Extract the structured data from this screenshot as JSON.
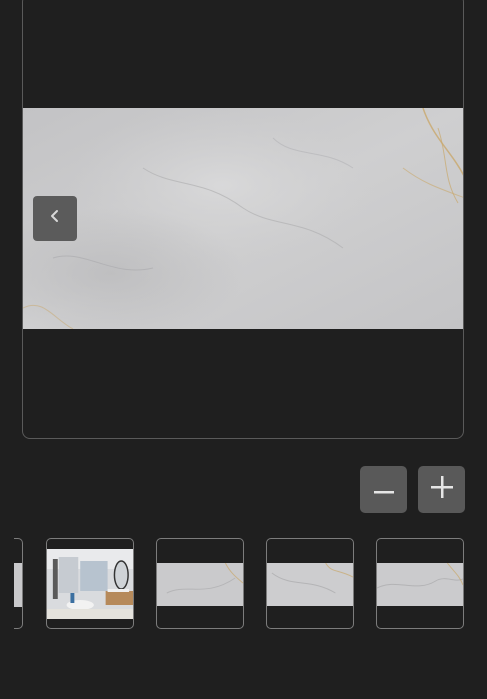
{
  "viewer": {
    "prev_icon": "chevron-left-icon",
    "image_kind": "marble-tile-onyx"
  },
  "zoom": {
    "zoom_out_icon": "minus-icon",
    "zoom_in_icon": "plus-icon"
  },
  "thumbnails": [
    {
      "kind": "partial-previous"
    },
    {
      "kind": "bathroom-scene",
      "selected": false
    },
    {
      "kind": "marble-tile"
    },
    {
      "kind": "marble-tile"
    },
    {
      "kind": "marble-tile"
    }
  ],
  "colors": {
    "background": "#1f1f1f",
    "button": "#595959",
    "border": "#7c7c7c"
  }
}
